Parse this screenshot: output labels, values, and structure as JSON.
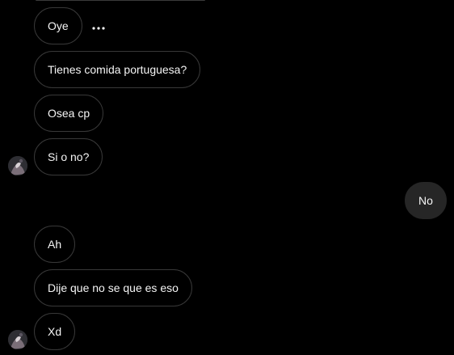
{
  "conversation": {
    "incoming_group_1": [
      {
        "text": "Oye"
      },
      {
        "text": "Tienes comida portuguesa?"
      },
      {
        "text": "Osea cp"
      },
      {
        "text": "Si o no?"
      }
    ],
    "outgoing": [
      {
        "text": "No"
      }
    ],
    "incoming_group_2": [
      {
        "text": "Ah"
      },
      {
        "text": "Dije que no se que es eso"
      },
      {
        "text": "Xd"
      }
    ]
  },
  "icons": {
    "message_options": "more-horizontal-icon",
    "sender_avatar": "avatar"
  },
  "colors": {
    "background": "#000000",
    "incoming_bubble_border": "#383838",
    "outgoing_bubble_fill": "#262626",
    "text": "#f5f5f5"
  }
}
